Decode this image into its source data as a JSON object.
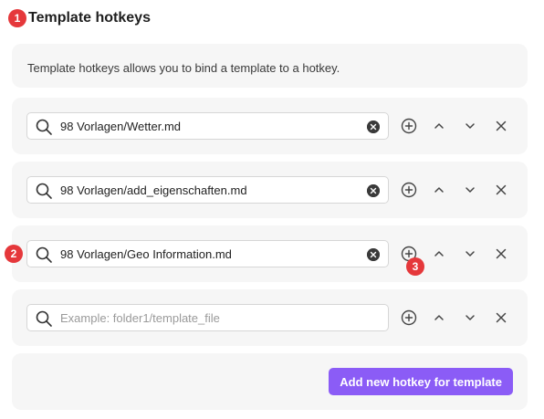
{
  "annotations": {
    "b1": "1",
    "b2": "2",
    "b3": "3"
  },
  "header": {
    "title": "Template hotkeys"
  },
  "description": "Template hotkeys allows you to bind a template to a hotkey.",
  "hotkeys": [
    {
      "value": "98 Vorlagen/Wetter.md"
    },
    {
      "value": "98 Vorlagen/add_eigenschaften.md"
    },
    {
      "value": "98 Vorlagen/Geo Information.md"
    },
    {
      "value": "",
      "placeholder": "Example: folder1/template_file"
    }
  ],
  "footer": {
    "add_label": "Add new hotkey for template"
  },
  "colors": {
    "accent": "#8b5cf6",
    "badge": "#e5383b",
    "card": "#f6f6f6"
  }
}
